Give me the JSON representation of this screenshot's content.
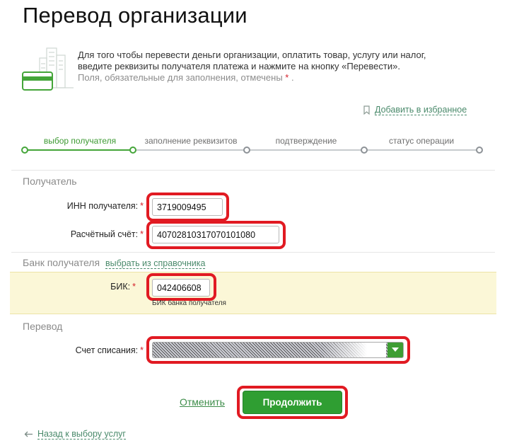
{
  "page": {
    "title": "Перевод организации"
  },
  "intro": {
    "line1": "Для того чтобы перевести деньги организации, оплатить товар, услугу или налог,",
    "line2": "введите реквизиты получателя платежа и нажмите на кнопку «Перевести».",
    "required_note": "Поля, обязательные для заполнения, отмечены",
    "required_star": "*",
    "required_end": "."
  },
  "favorite": {
    "label": "Добавить в избранное",
    "icon": "bookmark-icon"
  },
  "steps": [
    {
      "label": "выбор получателя",
      "active": true
    },
    {
      "label": "заполнение реквизитов",
      "active": false
    },
    {
      "label": "подтверждение",
      "active": false
    },
    {
      "label": "статус операции",
      "active": false
    }
  ],
  "recipient": {
    "section_title": "Получатель",
    "inn_label": "ИНН получателя:",
    "inn_value": "3719009495",
    "account_label": "Расчётный счёт:",
    "account_value": "40702810317070101080",
    "required_star": "*"
  },
  "bank": {
    "section_title": "Банк получателя",
    "directory_link": "выбрать из справочника",
    "bik_label": "БИК:",
    "bik_value": "042406608",
    "bik_help": "БИК банка получателя"
  },
  "transfer": {
    "section_title": "Перевод",
    "debit_label": "Счет списания:",
    "debit_value": ""
  },
  "actions": {
    "cancel_label": "Отменить",
    "continue_label": "Продолжить",
    "back_label": "Назад к выбору услуг"
  },
  "colors": {
    "accent_green": "#2f9e32",
    "link_green": "#4a8a6b",
    "highlight_red": "#e11a22",
    "required_red": "#d4202a",
    "bank_band": "#fbf7d7"
  }
}
